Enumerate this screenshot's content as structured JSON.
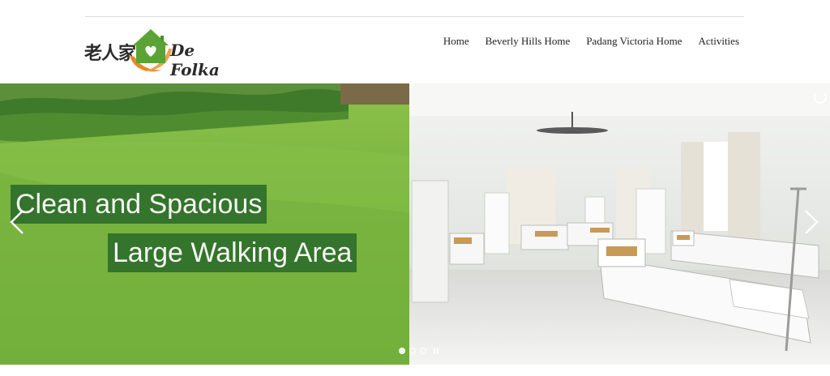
{
  "logo": {
    "chinese_text": "老人家",
    "brand_text": "De Folka",
    "colors": {
      "house_green": "#5aa334",
      "hands_orange": "#e58a2a",
      "heart": "#ffffff"
    }
  },
  "nav": {
    "items": [
      "Home",
      "Beverly Hills Home",
      "Padang Victoria Home",
      "Activities"
    ]
  },
  "slider": {
    "captions": [
      "Clean and Spacious",
      "Large Walking Area"
    ],
    "slides_count": 3,
    "active_slide": 1,
    "icons": {
      "prev": "chevron-left-icon",
      "next": "chevron-right-icon",
      "pause": "pause-icon",
      "loading": "spinner-icon"
    },
    "colors": {
      "caption_bg": "#2f6f2c",
      "grass": "#6fa53a",
      "room_wall": "#e9ebe8"
    }
  }
}
